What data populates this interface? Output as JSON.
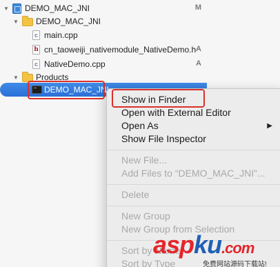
{
  "navigator": {
    "project": {
      "name": "DEMO_MAC_JNI",
      "badge": "M"
    },
    "group": {
      "name": "DEMO_MAC_JNI"
    },
    "files": [
      {
        "name": "main.cpp",
        "badge": "",
        "icon": "cpp-file-icon"
      },
      {
        "name": "cn_taoweiji_nativemodule_NativeDemo.h",
        "badge": "A",
        "icon": "h-header-file-icon"
      },
      {
        "name": "NativeDemo.cpp",
        "badge": "A",
        "icon": "cpp-file-icon"
      }
    ],
    "products_folder": {
      "name": "Products"
    },
    "product": {
      "name": "DEMO_MAC_JNI",
      "icon": "executable-icon"
    }
  },
  "context_menu": {
    "items": [
      {
        "label": "Show in Finder",
        "enabled": true,
        "highlighted": true
      },
      {
        "label": "Open with External Editor",
        "enabled": true
      },
      {
        "label": "Open As",
        "enabled": true,
        "submenu": true
      },
      {
        "label": "Show File Inspector",
        "enabled": true
      },
      {
        "label": "New File...",
        "enabled": false
      },
      {
        "label": "Add Files to “DEMO_MAC_JNI”...",
        "enabled": false
      },
      {
        "label": "Delete",
        "enabled": false
      },
      {
        "label": "New Group",
        "enabled": false
      },
      {
        "label": "New Group from Selection",
        "enabled": false
      },
      {
        "label": "Sort by Name",
        "enabled": false
      },
      {
        "label": "Sort by Type",
        "enabled": false
      }
    ],
    "submenu_arrow": "▶"
  },
  "watermark": {
    "main_a": "asp",
    "main_b": "ku",
    "main_c": ".com",
    "sub": "免费网站源码下载站!"
  },
  "colors": {
    "selection": "#2f74dc",
    "highlight_box": "#d9302b",
    "folder": "#f5c343",
    "disabled_text": "#a9a9a9"
  }
}
